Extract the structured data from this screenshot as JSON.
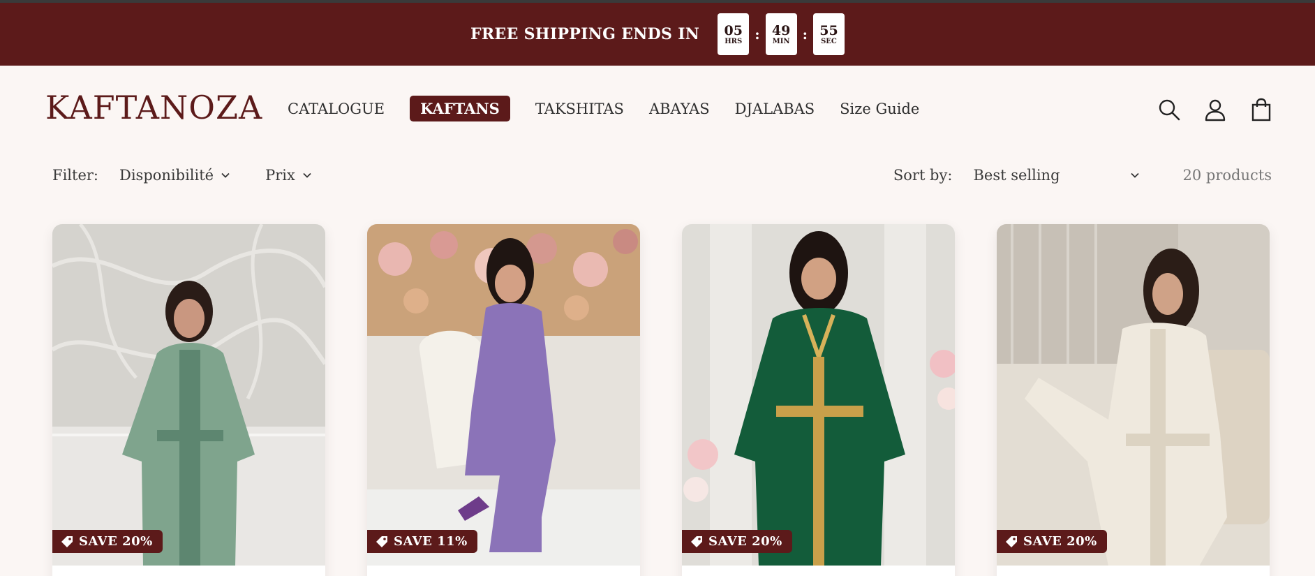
{
  "promo": {
    "text": "FREE SHIPPING ENDS IN",
    "timer": [
      {
        "value": "05",
        "unit": "HRS"
      },
      {
        "value": "49",
        "unit": "MIN"
      },
      {
        "value": "55",
        "unit": "SEC"
      }
    ],
    "separator": ":"
  },
  "header": {
    "logo": "KAFTANOZA",
    "nav": [
      {
        "label": "CATALOGUE",
        "active": false
      },
      {
        "label": "KAFTANS",
        "active": true
      },
      {
        "label": "TAKSHITAS",
        "active": false
      },
      {
        "label": "ABAYAS",
        "active": false
      },
      {
        "label": "DJALABAS",
        "active": false
      },
      {
        "label": "Size Guide",
        "active": false
      }
    ],
    "icons": [
      "search-icon",
      "account-icon",
      "cart-icon"
    ]
  },
  "filters": {
    "label": "Filter:",
    "availability": "Disponibilité",
    "price": "Prix",
    "sort_label": "Sort by:",
    "sort_value": "Best selling",
    "count": "20 products"
  },
  "products": [
    {
      "badge": "SAVE 20%",
      "dress_color": "#7fa48d",
      "bg": "#d9d7d2"
    },
    {
      "badge": "SAVE 11%",
      "dress_color": "#8b73b8",
      "bg": "#e7e3de"
    },
    {
      "badge": "SAVE 20%",
      "dress_color": "#135c3a",
      "bg": "#e1dfda"
    },
    {
      "badge": "SAVE 20%",
      "dress_color": "#efe9de",
      "bg": "#d6d1c8"
    }
  ],
  "colors": {
    "brand": "#5c1a1a",
    "background": "#fbf6f4"
  }
}
